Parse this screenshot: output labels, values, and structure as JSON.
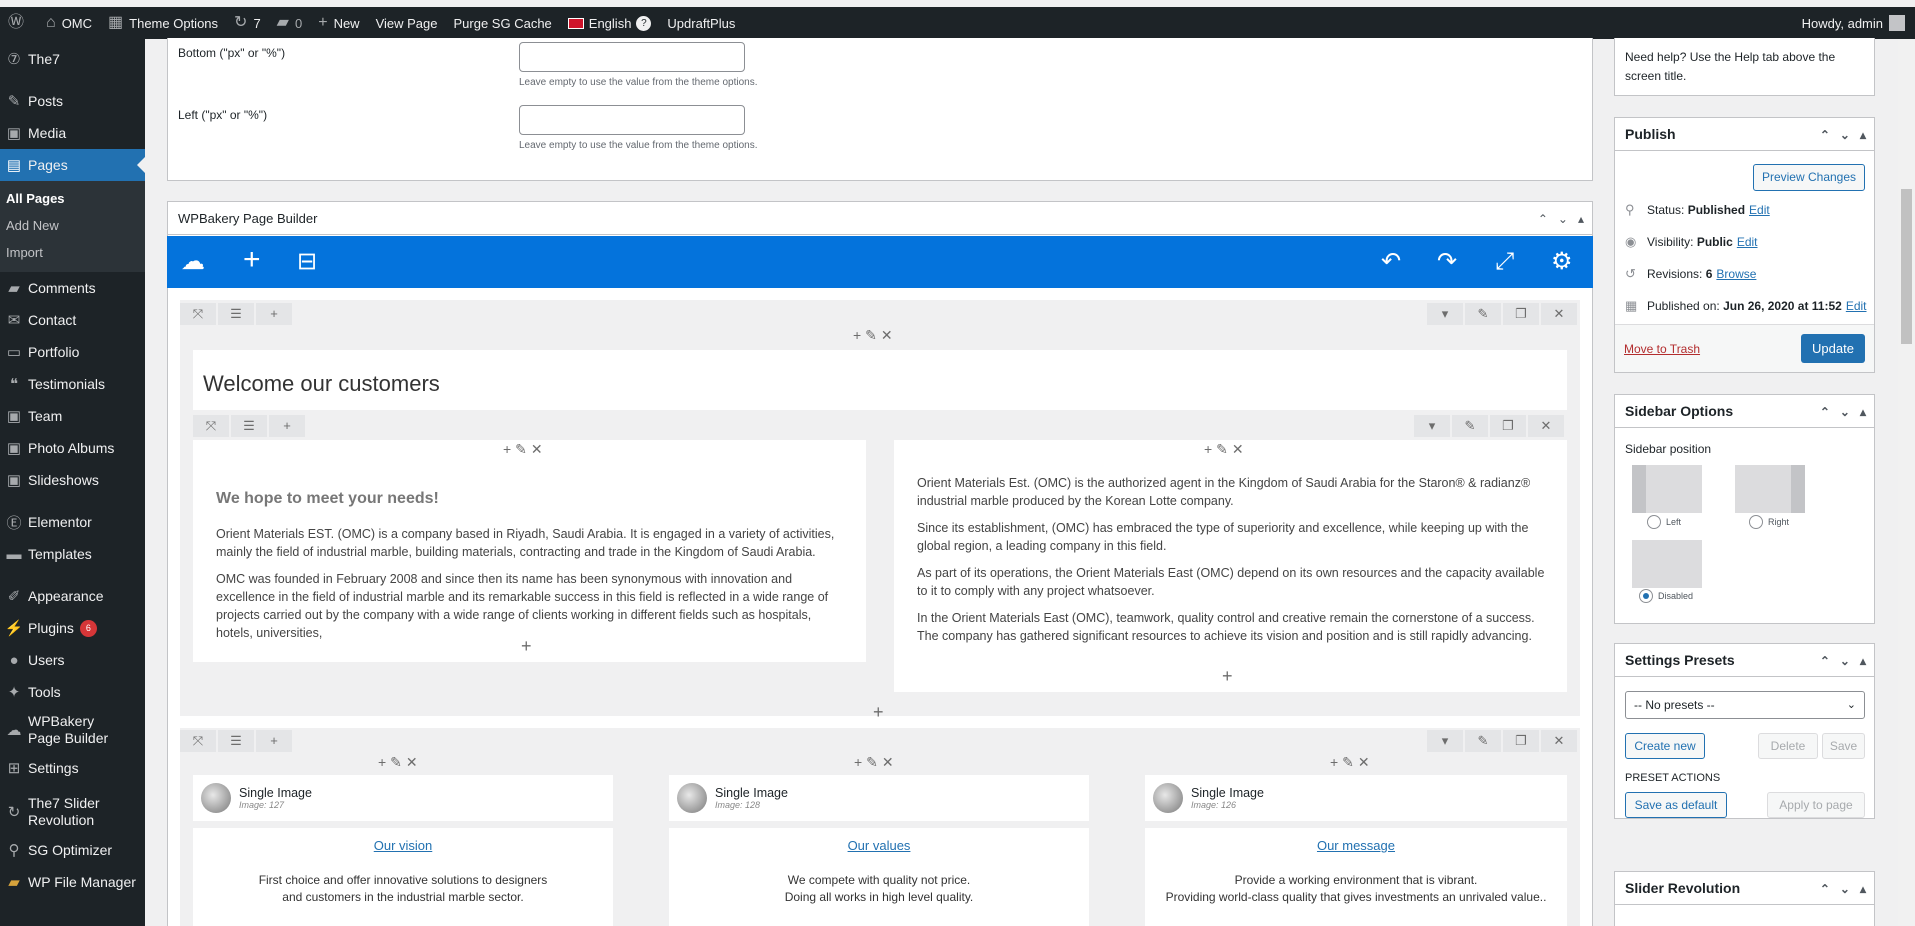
{
  "topbar": {
    "site_name": "OMC",
    "theme_options": "Theme Options",
    "updates_count": "7",
    "comments_count": "0",
    "new_label": "New",
    "view_page": "View Page",
    "purge_cache": "Purge SG Cache",
    "language": "English",
    "language_badge": "?",
    "updraft": "UpdraftPlus",
    "howdy": "Howdy, admin"
  },
  "menu": {
    "the7": "The7",
    "posts": "Posts",
    "media": "Media",
    "pages": "Pages",
    "sub_all_pages": "All Pages",
    "sub_add_new": "Add New",
    "sub_import": "Import",
    "comments": "Comments",
    "contact": "Contact",
    "portfolio": "Portfolio",
    "testimonials": "Testimonials",
    "team": "Team",
    "photo_albums": "Photo Albums",
    "slideshows": "Slideshows",
    "elementor": "Elementor",
    "templates": "Templates",
    "appearance": "Appearance",
    "plugins": "Plugins",
    "plugins_badge": "6",
    "users": "Users",
    "tools": "Tools",
    "wpbakery": "WPBakery Page Builder",
    "settings": "Settings",
    "the7_slider": "The7 Slider Revolution",
    "sg_optimizer": "SG Optimizer",
    "wp_file_manager": "WP File Manager"
  },
  "padding": {
    "bottom_label": "Bottom (\"px\" or \"%\")",
    "left_label": "Left (\"px\" or \"%\")",
    "hint": "Leave empty to use the value from the theme options."
  },
  "builder": {
    "title": "WPBakery Page Builder",
    "heading": "Welcome our customers",
    "left_col": {
      "subheading": "We hope to meet your needs!",
      "p1": "Orient Materials EST. (OMC) is a company based in Riyadh, Saudi Arabia. It is engaged in a variety of activities, mainly the field of industrial marble, building materials, contracting and trade in the Kingdom of Saudi Arabia.",
      "p2": "OMC was founded in February 2008 and since then its name has been synonymous with innovation and excellence in the field of industrial marble and its remarkable success in this field is reflected in a wide range of projects carried out by the company with a wide range of clients working in different fields such as hospitals, hotels, universities,"
    },
    "right_col": {
      "p1": "Orient Materials Est. (OMC) is the authorized agent in the Kingdom of Saudi Arabia for the Staron® & radianz® industrial marble produced by the Korean Lotte company.",
      "p2": "Since its establishment, (OMC) has embraced the type of superiority and excellence, while keeping up with the global region, a leading company in this field.",
      "p3": "As part of its operations, the Orient Materials East (OMC) depend on its own resources and the capacity available to it to comply with any project whatsoever.",
      "p4": "In the Orient Materials East (OMC), teamwork, quality control and creative remain the cornerstone of a success. The company has gathered significant resources to achieve its vision and position and is still rapidly advancing."
    },
    "images": [
      {
        "title": "Single Image",
        "sub": "Image: 127",
        "link": "Our vision",
        "line1": "First choice and offer innovative solutions to designers",
        "line2": "and customers in the industrial marble sector."
      },
      {
        "title": "Single Image",
        "sub": "Image: 128",
        "link": "Our values",
        "line1": "We compete with quality not price.",
        "line2": "Doing all works in high level quality."
      },
      {
        "title": "Single Image",
        "sub": "Image: 126",
        "link": "Our message",
        "line1": "Provide a working environment that is vibrant.",
        "line2": "Providing world-class quality that gives investments an unrivaled value.."
      }
    ]
  },
  "sidebar": {
    "help_text": "Need help? Use the Help tab above the screen title.",
    "publish": {
      "title": "Publish",
      "preview": "Preview Changes",
      "status_label": "Status:",
      "status_value": "Published",
      "visibility_label": "Visibility:",
      "visibility_value": "Public",
      "revisions_label": "Revisions:",
      "revisions_value": "6",
      "browse": "Browse",
      "published_label": "Published on:",
      "published_value": "Jun 26, 2020 at 11:52",
      "edit": "Edit",
      "trash": "Move to Trash",
      "update": "Update"
    },
    "sidebar_options": {
      "title": "Sidebar Options",
      "position_label": "Sidebar position",
      "left": "Left",
      "right": "Right",
      "disabled": "Disabled"
    },
    "presets": {
      "title": "Settings Presets",
      "select_value": "-- No presets --",
      "create": "Create new",
      "delete": "Delete",
      "save": "Save",
      "actions_label": "PRESET ACTIONS",
      "save_default": "Save as default",
      "apply": "Apply to page"
    },
    "slider": {
      "title": "Slider Revolution"
    }
  }
}
